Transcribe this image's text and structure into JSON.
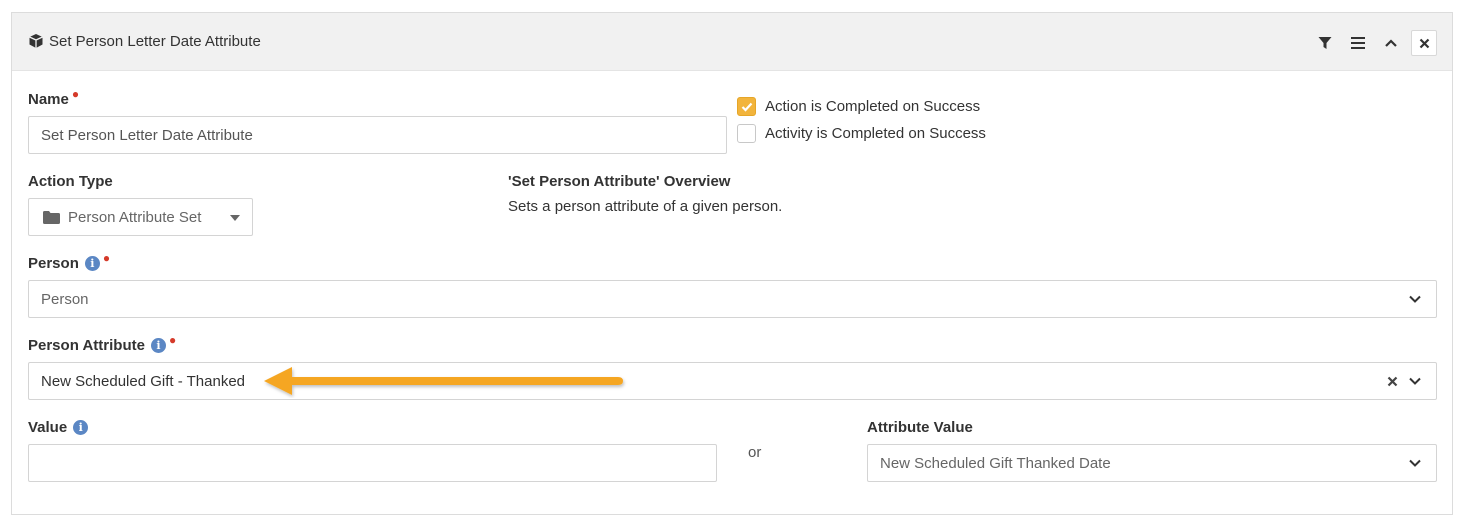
{
  "header": {
    "title": "Set Person Letter Date Attribute",
    "icons": [
      "cube-icon",
      "filter-icon",
      "menu-icon",
      "chevron-up-icon",
      "close-icon"
    ]
  },
  "form": {
    "name": {
      "label": "Name",
      "value": "Set Person Letter Date Attribute",
      "required": true
    },
    "action_completed": {
      "label": "Action is Completed on Success",
      "checked": true
    },
    "activity_completed": {
      "label": "Activity is Completed on Success",
      "checked": false
    },
    "action_type": {
      "label": "Action Type",
      "value": "Person Attribute Set",
      "icon": "folder-icon"
    },
    "overview": {
      "title": "'Set Person Attribute' Overview",
      "description": "Sets a person attribute of a given person."
    },
    "person": {
      "label": "Person",
      "value": "Person",
      "required": true,
      "info": "i"
    },
    "person_attribute": {
      "label": "Person Attribute",
      "value": "New Scheduled Gift - Thanked",
      "required": true,
      "info": "i"
    },
    "value": {
      "label": "Value",
      "value": "",
      "info": "i"
    },
    "or_text": "or",
    "attribute_value": {
      "label": "Attribute Value",
      "value": "New Scheduled Gift Thanked Date"
    }
  },
  "colors": {
    "accent_checkbox": "#f2b43c",
    "arrow": "#f5a623",
    "required": "#d53a2a",
    "info": "#5b87c4"
  }
}
